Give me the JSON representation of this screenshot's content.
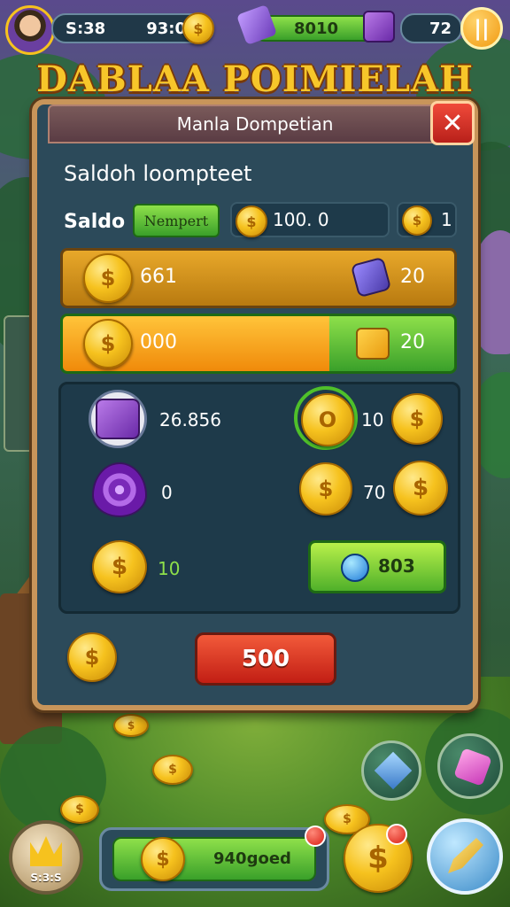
{
  "top_bar": {
    "timer": "S:38",
    "coin_count": "93:0",
    "quest_value": "8010",
    "gem_count": "72",
    "pause_symbol": "||"
  },
  "title": "DABLAA POIMIELAH",
  "panel": {
    "header": "Manla Dompetian",
    "close_symbol": "✕",
    "subtitle": "Saldoh loompteet",
    "saldo_label": "Saldo",
    "saldo_badge": "Nempert",
    "saldo_amount": "100. 0",
    "saldo_extra": "1",
    "gold_row": {
      "left_value": "661",
      "right_value": "20"
    },
    "progress_row": {
      "left_value": "000",
      "right_value": "20",
      "fill_fraction": 0.68
    },
    "items": {
      "chest_value": "26.856",
      "ring_coin_value": "10",
      "swirl_value": "0",
      "coin_pair_value": "70",
      "small_coin_value": "10",
      "green_button_value": "803"
    },
    "confirm_button": "500"
  },
  "bottom_bar": {
    "left_badge": "S:3:S",
    "wallet_value": "940goed"
  },
  "colors": {
    "gold": "#f6c21e",
    "panel_bg": "#2c4a5a",
    "panel_border": "#c8955a",
    "green": "#4fc02a",
    "red": "#d8261a",
    "purple": "#7a2ab8"
  }
}
